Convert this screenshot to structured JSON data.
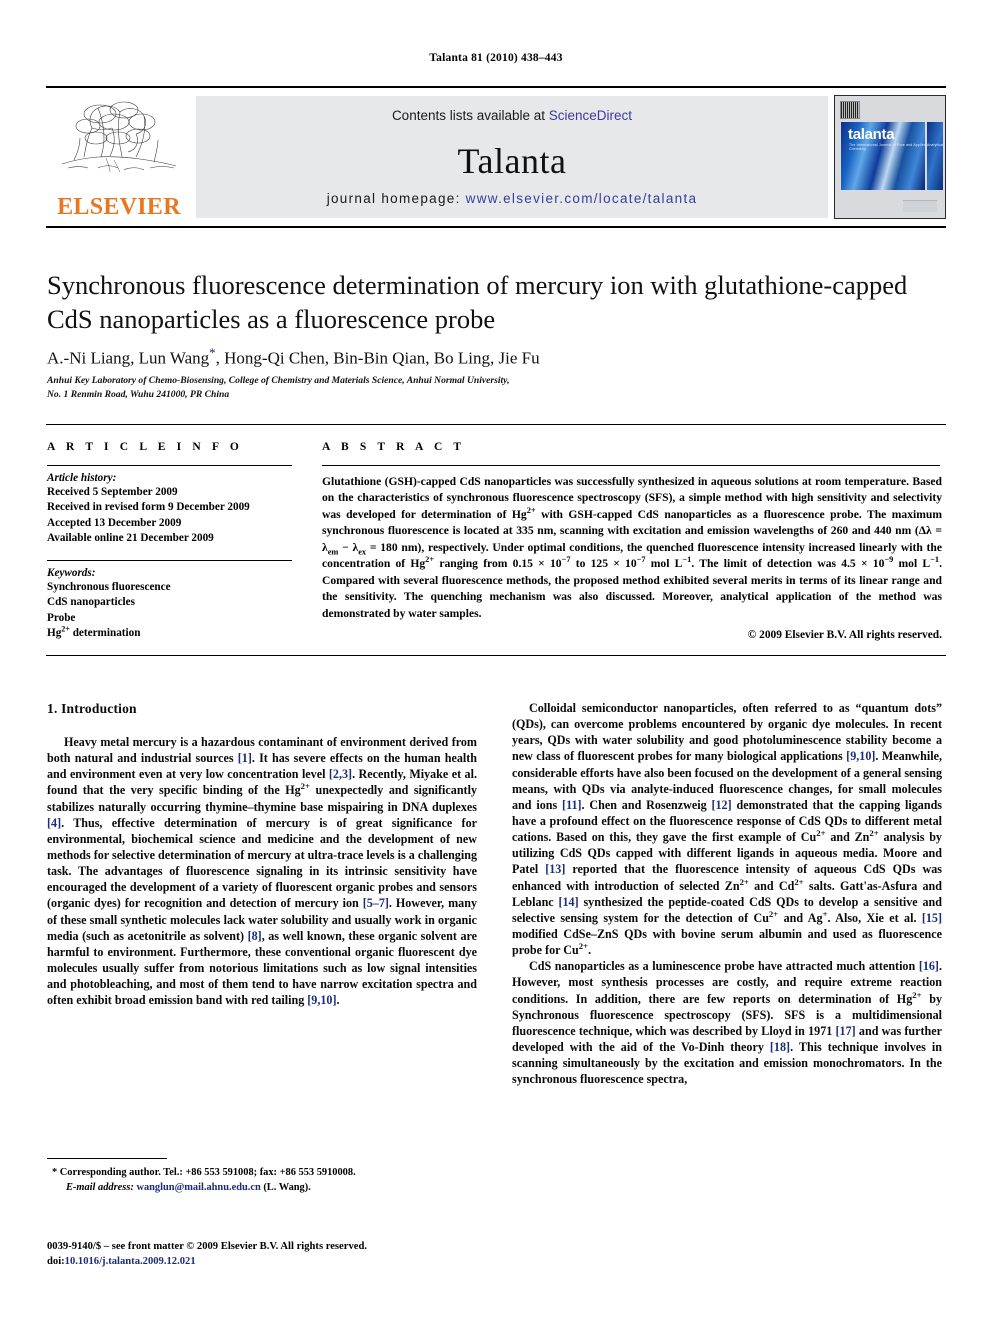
{
  "running_head": "Talanta 81 (2010) 438–443",
  "masthead": {
    "publisher": "ELSEVIER",
    "contents_prefix": "Contents lists available at ",
    "contents_link": "ScienceDirect",
    "journal": "Talanta",
    "homepage_prefix": "journal homepage: ",
    "homepage_url": "www.elsevier.com/locate/talanta",
    "cover_title": "talanta",
    "cover_subtitle": "The International Journal of Pure and Applied Analytical Chemistry",
    "link_color": "#3b3b9e",
    "elsevier_orange": "#E87722"
  },
  "article": {
    "title": "Synchronous fluorescence determination of mercury ion with glutathione-capped CdS nanoparticles as a fluorescence probe",
    "authors": "A.-Ni Liang, Lun Wang",
    "authors_rest": ", Hong-Qi Chen, Bin-Bin Qian, Bo Ling, Jie Fu",
    "corresponding_marker": "*",
    "affiliation_line1": "Anhui Key Laboratory of Chemo-Biosensing, College of Chemistry and Materials Science, Anhui Normal University,",
    "affiliation_line2": "No. 1 Renmin Road, Wuhu 241000, PR China"
  },
  "article_info": {
    "heading": "A R T I C L E  I N F O",
    "history_label": "Article history:",
    "history": [
      "Received 5 September 2009",
      "Received in revised form 9 December 2009",
      "Accepted 13 December 2009",
      "Available online 21 December 2009"
    ],
    "keywords_label": "Keywords:",
    "keywords_1": "Synchronous fluorescence",
    "keywords_2": "CdS nanoparticles",
    "keywords_3": "Probe",
    "keywords_4_prefix": "Hg",
    "keywords_4_sup": "2+",
    "keywords_4_suffix": " determination"
  },
  "abstract": {
    "heading": "A B S T R A C T",
    "p1": "Glutathione (GSH)-capped CdS nanoparticles was successfully synthesized in aqueous solutions at room temperature. Based on the characteristics of synchronous fluorescence spectroscopy (SFS), a simple method with high sensitivity and selectivity was developed for determination of Hg",
    "p1_sup1": "2+",
    "p2": " with GSH-capped CdS nanoparticles as a fluorescence probe. The maximum synchronous fluorescence is located at 335 nm, scanning with excitation and emission wavelengths of 260 and 440 nm (Δλ = λ",
    "p2_sub1": "em",
    "p3": " − λ",
    "p3_sub1": "ex",
    "p4": " = 180 nm), respectively. Under optimal conditions, the quenched fluorescence intensity increased linearly with the concentration of Hg",
    "p4_sup1": "2+",
    "p5": " ranging from 0.15 × 10",
    "p5_sup1": "−7",
    "p6": " to 125 × 10",
    "p6_sup1": "−7",
    "p7": " mol L",
    "p7_sup1": "−1",
    "p8": ". The limit of detection was 4.5 × 10",
    "p8_sup1": "−9",
    "p9": " mol L",
    "p9_sup1": "−1",
    "p10": ". Compared with several fluorescence methods, the proposed method exhibited several merits in terms of its linear range and the sensitivity. The quenching mechanism was also discussed. Moreover, analytical application of the method was demonstrated by water samples.",
    "copyright": "© 2009 Elsevier B.V. All rights reserved."
  },
  "body": {
    "section_heading": "1.  Introduction",
    "left": {
      "p1_a": "Heavy metal mercury is a hazardous contaminant of environment derived from both natural and industrial sources ",
      "p1_r1": "[1]",
      "p1_b": ". It has severe effects on the human health and environment even at very low concentration level ",
      "p1_r2": "[2,3]",
      "p1_c": ". Recently, Miyake et al. found that the very specific binding of the Hg",
      "p1_sup1": "2+",
      "p1_d": " unexpectedly and significantly stabilizes naturally occurring thymine–thymine base mispairing in DNA duplexes ",
      "p1_r3": "[4]",
      "p1_e": ". Thus, effective determination of mercury is of great significance for environmental, biochemical science and medicine and the development of new methods for selective determination of mercury at ultra-trace levels is a challenging task. The advantages of fluorescence signaling in its intrinsic sensitivity have encouraged the development of a variety of fluorescent organic probes and sensors (organic dyes) for recognition and detection of mercury ion ",
      "p1_r4": "[5–7]",
      "p1_f": ". However, many of these small synthetic molecules lack water solubility and usually work in organic media (such as acetonitrile as solvent) ",
      "p1_r5": "[8]",
      "p1_g": ", as well known, these organic solvent are harmful to environment. Furthermore, these conventional organic fluorescent dye molecules usually suffer from notorious limitations such as low signal intensities and photobleaching, and most of them tend to have narrow excitation spectra and often exhibit broad emission band with red tailing ",
      "p1_r6": "[9,10]",
      "p1_h": "."
    },
    "right": {
      "p1_a": "Colloidal semiconductor nanoparticles, often referred to as “quantum dots” (QDs), can overcome problems encountered by organic dye molecules. In recent years, QDs with water solubility and good photoluminescence stability become a new class of fluorescent probes for many biological applications ",
      "p1_r1": "[9,10]",
      "p1_b": ". Meanwhile, considerable efforts have also been focused on the development of a general sensing means, with QDs via analyte-induced fluorescence changes, for small molecules and ions ",
      "p1_r2": "[11]",
      "p1_c": ". Chen and Rosenzweig ",
      "p1_r3": "[12]",
      "p1_d": " demonstrated that the capping ligands have a profound effect on the fluorescence response of CdS QDs to different metal cations. Based on this, they gave the first example of Cu",
      "p1_sup1": "2+",
      "p1_e": " and Zn",
      "p1_sup2": "2+",
      "p1_f": " analysis by utilizing CdS QDs capped with different ligands in aqueous media. Moore and Patel ",
      "p1_r4": "[13]",
      "p1_g": " reported that the fluorescence intensity of aqueous CdS QDs was enhanced with introduction of selected Zn",
      "p1_sup3": "2+",
      "p1_h": " and Cd",
      "p1_sup4": "2+",
      "p1_i": " salts. Gatt'as-Asfura and Leblanc ",
      "p1_r5": "[14]",
      "p1_j": " synthesized the peptide-coated CdS QDs to develop a sensitive and selective sensing system for the detection of Cu",
      "p1_sup5": "2+",
      "p1_k": " and Ag",
      "p1_sup6": "+",
      "p1_l": ". Also, Xie et al. ",
      "p1_r6": "[15]",
      "p1_m": " modified CdSe–ZnS QDs with bovine serum albumin and used as fluorescence probe for Cu",
      "p1_sup7": "2+",
      "p1_n": ".",
      "p2_a": "CdS nanoparticles as a luminescence probe have attracted much attention ",
      "p2_r1": "[16]",
      "p2_b": ". However, most synthesis processes are costly, and require extreme reaction conditions. In addition, there are few reports on determination of Hg",
      "p2_sup1": "2+",
      "p2_c": " by Synchronous fluorescence spectroscopy (SFS). SFS is a multidimensional fluorescence technique, which was described by Lloyd in 1971 ",
      "p2_r2": "[17]",
      "p2_d": " and was further developed with the aid of the Vo-Dinh theory ",
      "p2_r3": "[18]",
      "p2_e": ". This technique involves in scanning simultaneously by the excitation and emission monochromators. In the synchronous fluorescence spectra,"
    }
  },
  "footer": {
    "corresponding": "* Corresponding author. Tel.: +86 553 591008; fax: +86 553 5910008.",
    "email_label": "E-mail address:",
    "email": "wanglun@mail.ahnu.edu.cn",
    "email_suffix": " (L. Wang).",
    "imprint": "0039-9140/$ – see front matter © 2009 Elsevier B.V. All rights reserved.",
    "doi_label": "doi:",
    "doi": "10.1016/j.talanta.2009.12.021"
  }
}
